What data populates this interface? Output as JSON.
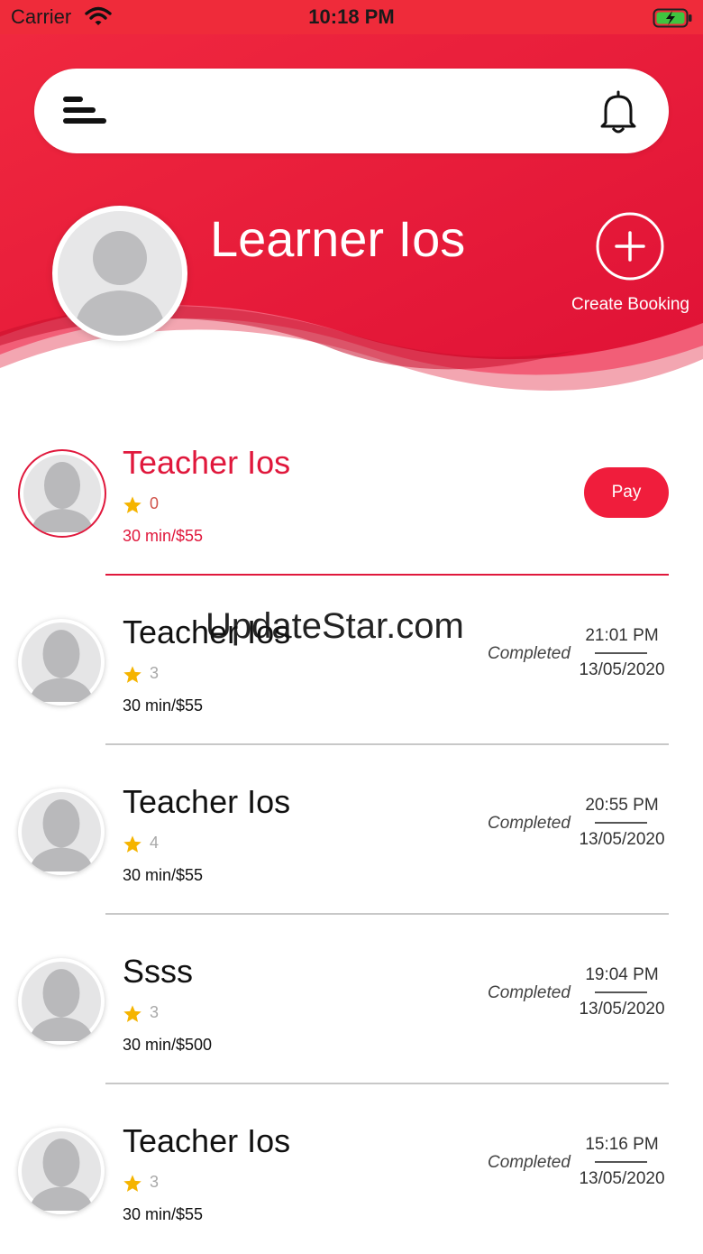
{
  "status_bar": {
    "carrier": "Carrier",
    "time": "10:18 PM"
  },
  "profile": {
    "name": "Learner Ios",
    "create_booking_label": "Create Booking"
  },
  "bookings": [
    {
      "name": "Teacher Ios",
      "rating": "0",
      "price": "30 min/$55",
      "action_label": "Pay",
      "active": true
    },
    {
      "name": "Teacher Ios",
      "rating": "3",
      "price": "30 min/$55",
      "status": "Completed",
      "time": "21:01 PM",
      "date": "13/05/2020"
    },
    {
      "name": "Teacher Ios",
      "rating": "4",
      "price": "30 min/$55",
      "status": "Completed",
      "time": "20:55 PM",
      "date": "13/05/2020"
    },
    {
      "name": "Ssss",
      "rating": "3",
      "price": "30 min/$500",
      "status": "Completed",
      "time": "19:04 PM",
      "date": "13/05/2020"
    },
    {
      "name": "Teacher Ios",
      "rating": "3",
      "price": "30 min/$55",
      "status": "Completed",
      "time": "15:16 PM",
      "date": "13/05/2020"
    }
  ],
  "watermark": "UpdateStar.com",
  "colors": {
    "brand_red": "#e0183c",
    "header_red": "#ef2b3a",
    "star": "#f5b400"
  },
  "icons": [
    "wifi-icon",
    "battery-icon",
    "menu-icon",
    "bell-icon",
    "plus-icon",
    "star-icon",
    "avatar-placeholder-icon"
  ]
}
